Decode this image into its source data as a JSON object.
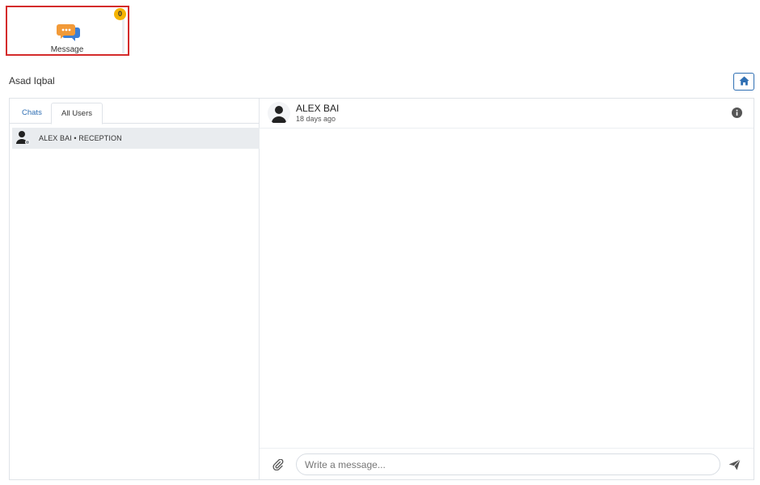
{
  "app": {
    "message_tile": {
      "label": "Message",
      "badge_count": "0",
      "icon": "chat-bubbles-icon"
    }
  },
  "header": {
    "user_name": "Asad Iqbal",
    "home_icon": "home-icon"
  },
  "sidebar": {
    "tabs": [
      {
        "label": "Chats",
        "active": false
      },
      {
        "label": "All Users",
        "active": true
      }
    ],
    "users": [
      {
        "label": "ALEX BAI • RECEPTION",
        "status": "offline"
      }
    ]
  },
  "chat": {
    "contact_name": "ALEX BAI",
    "last_seen": "18 days ago",
    "info_icon": "info-icon",
    "composer": {
      "placeholder": "Write a message...",
      "attach_icon": "paperclip-icon",
      "send_icon": "send-icon"
    }
  },
  "colors": {
    "accent": "#2f6fb3",
    "badge": "#f5b400",
    "highlight_border": "#d42b2b"
  }
}
